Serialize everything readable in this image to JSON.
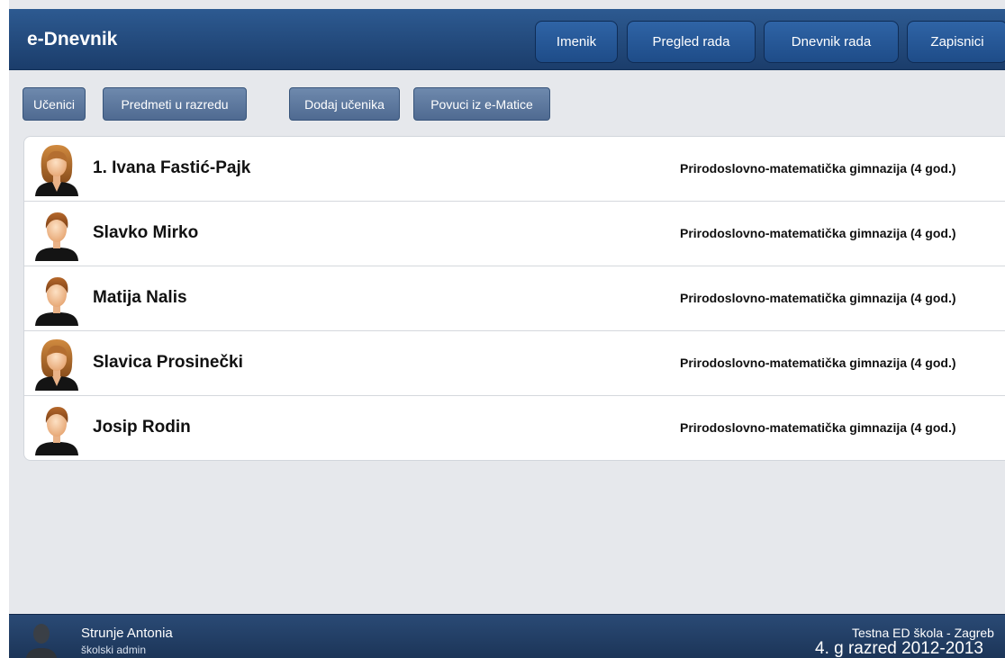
{
  "header": {
    "title": "e-Dnevnik",
    "nav": [
      {
        "label": "Imenik"
      },
      {
        "label": "Pregled rada"
      },
      {
        "label": "Dnevnik rada"
      },
      {
        "label": "Zapisnici"
      }
    ]
  },
  "toolbar": {
    "buttons": [
      {
        "label": "Učenici"
      },
      {
        "label": "Predmeti u razredu"
      },
      {
        "label": "Dodaj učenika"
      },
      {
        "label": "Povuci iz e-Matice"
      }
    ]
  },
  "students": [
    {
      "name": "1. Ivana Fastić-Pajk",
      "program": "Prirodoslovno-matematička gimnazija (4 god.)",
      "avatar": "female-avatar-icon"
    },
    {
      "name": "Slavko Mirko",
      "program": "Prirodoslovno-matematička gimnazija (4 god.)",
      "avatar": "male-avatar-icon"
    },
    {
      "name": "Matija Nalis",
      "program": "Prirodoslovno-matematička gimnazija (4 god.)",
      "avatar": "male-avatar-icon"
    },
    {
      "name": "Slavica Prosinečki",
      "program": "Prirodoslovno-matematička gimnazija (4 god.)",
      "avatar": "female-avatar-icon"
    },
    {
      "name": "Josip Rodin",
      "program": "Prirodoslovno-matematička gimnazija (4 god.)",
      "avatar": "male-avatar-icon"
    }
  ],
  "footer": {
    "user_name": "Strunje Antonia",
    "user_role": "školski admin",
    "school": "Testna ED škola - Zagreb",
    "class": "4. g razred 2012-2013"
  },
  "colors": {
    "header_bg": "#1f4476",
    "toolbar_button": "#5d78a0",
    "page_bg": "#e6e8ec",
    "footer_bg": "#213e64"
  }
}
